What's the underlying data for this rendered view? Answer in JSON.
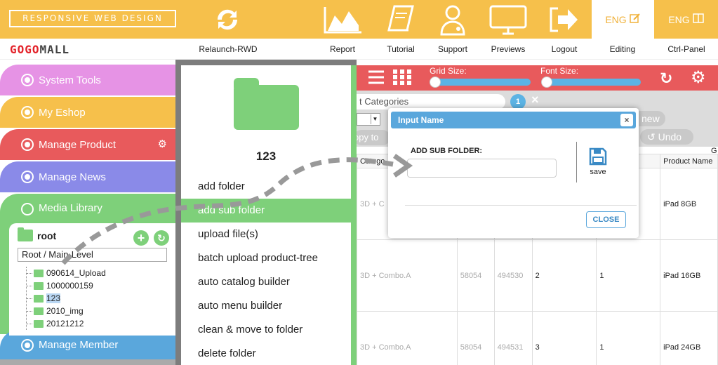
{
  "topbar": {
    "badge": "RESPONSIVE WEB DESIGN",
    "eng_editing": "ENG",
    "eng_ctrl": "ENG",
    "nav": [
      {
        "id": "relaunch",
        "label": "Relaunch-RWD",
        "icon": "refresh-icon"
      },
      {
        "id": "report",
        "label": "Report",
        "icon": "chart-icon"
      },
      {
        "id": "tutorial",
        "label": "Tutorial",
        "icon": "book-icon"
      },
      {
        "id": "support",
        "label": "Support",
        "icon": "doctor-icon"
      },
      {
        "id": "previews",
        "label": "Previews",
        "icon": "monitor-icon"
      },
      {
        "id": "logout",
        "label": "Logout",
        "icon": "logout-arrow-icon"
      },
      {
        "id": "editing",
        "label": "Editing",
        "icon": "edit-icon"
      },
      {
        "id": "ctrl",
        "label": "Ctrl-Panel",
        "icon": "panel-icon"
      }
    ]
  },
  "logo": {
    "part1": "GOGO",
    "part2": "MALL"
  },
  "leftmenu": {
    "items": [
      {
        "label": "System Tools",
        "color": "#e693e5"
      },
      {
        "label": "My Eshop",
        "color": "#f6c04b"
      },
      {
        "label": "Manage Product",
        "color": "#e85a5c"
      },
      {
        "label": "Manage News",
        "color": "#8a8ae8"
      },
      {
        "label": "Media Library",
        "color": "#7ed07a"
      },
      {
        "label": "Manage Member",
        "color": "#5aa7dc"
      }
    ],
    "root_label": "root",
    "select_value": "Root / Main-Level",
    "tree": [
      "090614_Upload",
      "1000000159",
      "123",
      "2010_img",
      "20121212"
    ]
  },
  "context": {
    "folder_name": "123",
    "items": [
      "add folder",
      "add sub folder",
      "upload file(s)",
      "batch upload product-tree",
      "auto catalog builder",
      "auto menu builder",
      "clean & move to folder",
      "delete folder"
    ]
  },
  "right": {
    "grid_size_label": "Grid Size:",
    "font_size_label": "Font Size:",
    "categories_tab": "t Categories",
    "badge_count": "1",
    "new_label": "new",
    "copy_label": "opy to",
    "undo_label": "Undo",
    "col_g": "G",
    "table": {
      "headers": [
        "Catego",
        "",
        "",
        "",
        "",
        "Product Name"
      ],
      "rows": [
        [
          "3D + C",
          "",
          "",
          "",
          "",
          "iPad 8GB"
        ],
        [
          "3D + Combo.A",
          "58054",
          "494530",
          "2",
          "1",
          "iPad 16GB"
        ],
        [
          "3D + Combo.A",
          "58054",
          "494531",
          "3",
          "1",
          "iPad 24GB"
        ]
      ]
    }
  },
  "modal": {
    "title": "Input Name",
    "close_x": "×",
    "field_label": "ADD SUB FOLDER:",
    "input_value": "",
    "save_label": "save",
    "close_label": "CLOSE"
  }
}
